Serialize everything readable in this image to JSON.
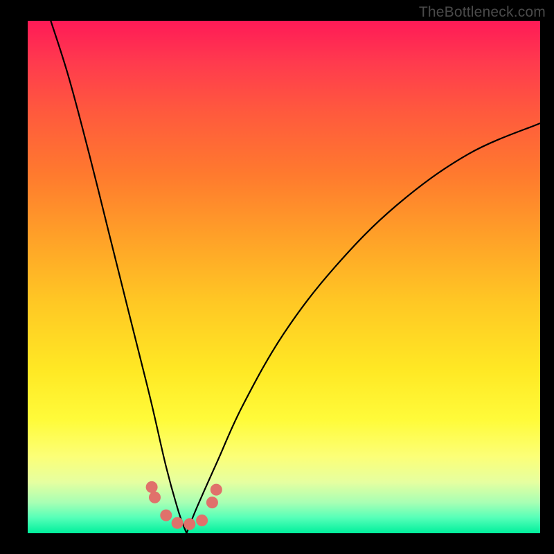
{
  "watermark": "TheBottleneck.com",
  "chart_data": {
    "type": "line",
    "title": "",
    "xlabel": "",
    "ylabel": "",
    "xlim": [
      0,
      1
    ],
    "ylim": [
      0,
      1
    ],
    "note": "Values are normalized fractions of the plot area. Two curved lines descend to a V near x≈0.31, y≈0; scattered points sit near the trough.",
    "series": [
      {
        "name": "left-curve",
        "x": [
          0.045,
          0.08,
          0.12,
          0.16,
          0.2,
          0.24,
          0.27,
          0.295,
          0.31
        ],
        "y": [
          1.0,
          0.89,
          0.74,
          0.58,
          0.42,
          0.26,
          0.13,
          0.04,
          0.0
        ]
      },
      {
        "name": "right-curve",
        "x": [
          0.31,
          0.33,
          0.37,
          0.42,
          0.5,
          0.6,
          0.72,
          0.86,
          1.0
        ],
        "y": [
          0.0,
          0.05,
          0.14,
          0.25,
          0.39,
          0.52,
          0.64,
          0.74,
          0.8
        ]
      }
    ],
    "points": [
      {
        "x": 0.242,
        "y": 0.09
      },
      {
        "x": 0.248,
        "y": 0.07
      },
      {
        "x": 0.27,
        "y": 0.035
      },
      {
        "x": 0.292,
        "y": 0.02
      },
      {
        "x": 0.316,
        "y": 0.018
      },
      {
        "x": 0.34,
        "y": 0.025
      },
      {
        "x": 0.36,
        "y": 0.06
      },
      {
        "x": 0.368,
        "y": 0.085
      }
    ],
    "colors": {
      "gradient_top": "#ff1a57",
      "gradient_mid": "#ffe824",
      "gradient_bottom": "#00ef9c",
      "curve": "#000000",
      "points": "#e0716b",
      "frame": "#000000"
    }
  }
}
